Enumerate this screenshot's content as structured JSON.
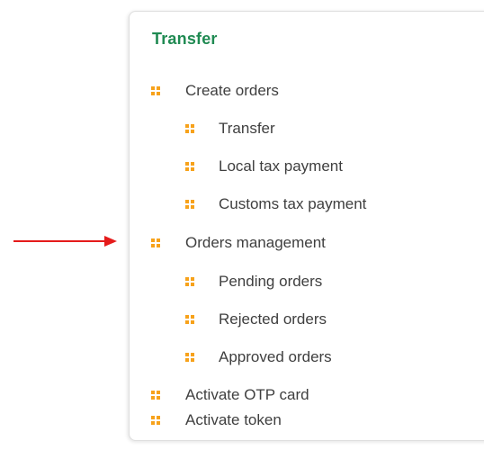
{
  "menu": {
    "title": "Transfer",
    "items": [
      {
        "label": "Create orders"
      },
      {
        "label": "Transfer"
      },
      {
        "label": "Local tax payment"
      },
      {
        "label": "Customs tax payment"
      },
      {
        "label": "Orders management"
      },
      {
        "label": "Pending orders"
      },
      {
        "label": "Rejected orders"
      },
      {
        "label": "Approved orders"
      },
      {
        "label": "Activate OTP card"
      },
      {
        "label": "Activate token"
      }
    ]
  },
  "colors": {
    "title": "#1f8a52",
    "bullet": "#f7a21b",
    "text": "#3f3f3f",
    "arrow": "#e51b1b"
  },
  "icons": {
    "bullet": "grid-bullet-icon",
    "arrow": "right-arrow-icon"
  }
}
